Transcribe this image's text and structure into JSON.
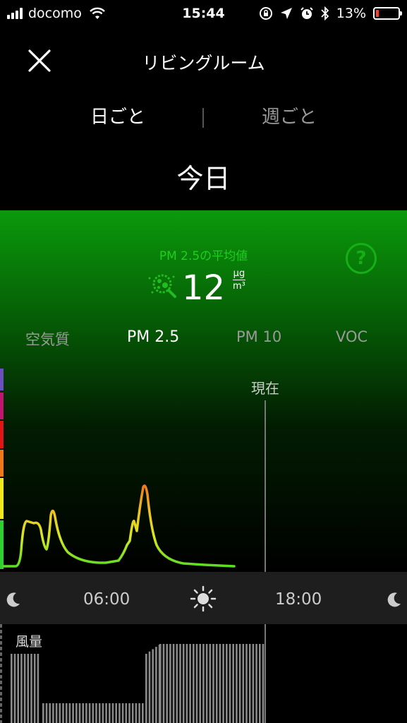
{
  "status_bar": {
    "carrier": "docomo",
    "time": "15:44",
    "battery_percent": "13%",
    "battery_level": 0.13
  },
  "header": {
    "title": "リビングルーム",
    "range_tabs": [
      {
        "label": "日ごと",
        "selected": true
      },
      {
        "label": "週ごと",
        "selected": false
      }
    ],
    "date": "今日"
  },
  "summary": {
    "average_label": "PM 2.5の平均値",
    "value": "12",
    "unit_top": "μg",
    "unit_bottom": "m³",
    "help_label": "?"
  },
  "metric_tabs": [
    {
      "label": "空気質",
      "selected": false
    },
    {
      "label": "PM 2.5",
      "selected": true
    },
    {
      "label": "PM 10",
      "selected": false
    },
    {
      "label": "VOC",
      "selected": false
    }
  ],
  "chart": {
    "now_label": "現在",
    "time_labels": [
      "06:00",
      "18:00"
    ],
    "level_colors": [
      "#6b4fbf",
      "#c0166f",
      "#e01616",
      "#f07818",
      "#f0e818",
      "#2fd12f"
    ],
    "colors": {
      "low": "#66dd22",
      "mid": "#e8e820",
      "high": "#f08020",
      "line_now": "#777777",
      "help_green": "#16b016"
    }
  },
  "fan": {
    "label": "風量"
  }
}
